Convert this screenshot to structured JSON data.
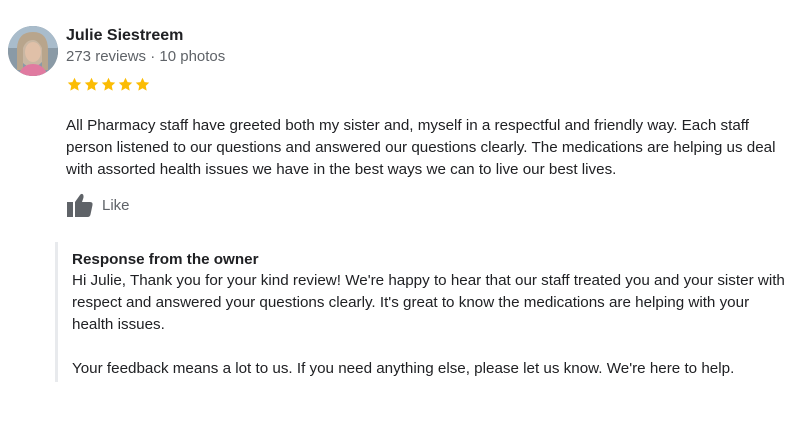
{
  "review": {
    "author": {
      "name": "Julie Siestreem",
      "meta": "273 reviews · 10 photos"
    },
    "rating": 5,
    "text": "All Pharmacy staff have greeted both my sister and, myself in a respectful and friendly way. Each staff person listened to our questions and answered our questions clearly. The medications are helping us deal with assorted health issues we have in the best ways we can to live our best lives.",
    "like_label": "Like"
  },
  "owner_response": {
    "title": "Response from the owner",
    "paragraph1": "Hi Julie, Thank you for your kind review! We're happy to hear that our staff treated you and your sister with respect and answered your questions clearly. It's great to know the medications are helping with your health issues.",
    "paragraph2": "Your feedback means a lot to us. If you need anything else, please let us know. We're here to help."
  },
  "colors": {
    "star": "#fbbc04",
    "like_icon": "#5f6368",
    "secondary_text": "#5f6368",
    "response_border": "#e8eaed"
  },
  "icons": {
    "star": "star-icon",
    "like": "thumbs-up-icon"
  }
}
